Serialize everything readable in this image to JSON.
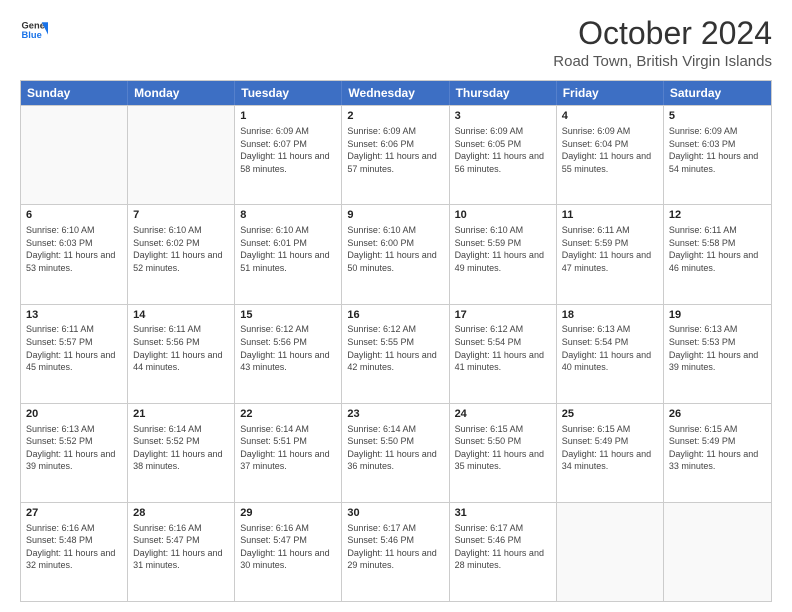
{
  "logo": {
    "line1": "General",
    "line2": "Blue"
  },
  "title": "October 2024",
  "subtitle": "Road Town, British Virgin Islands",
  "header_days": [
    "Sunday",
    "Monday",
    "Tuesday",
    "Wednesday",
    "Thursday",
    "Friday",
    "Saturday"
  ],
  "rows": [
    [
      {
        "day": "",
        "sunrise": "",
        "sunset": "",
        "daylight": ""
      },
      {
        "day": "",
        "sunrise": "",
        "sunset": "",
        "daylight": ""
      },
      {
        "day": "1",
        "sunrise": "Sunrise: 6:09 AM",
        "sunset": "Sunset: 6:07 PM",
        "daylight": "Daylight: 11 hours and 58 minutes."
      },
      {
        "day": "2",
        "sunrise": "Sunrise: 6:09 AM",
        "sunset": "Sunset: 6:06 PM",
        "daylight": "Daylight: 11 hours and 57 minutes."
      },
      {
        "day": "3",
        "sunrise": "Sunrise: 6:09 AM",
        "sunset": "Sunset: 6:05 PM",
        "daylight": "Daylight: 11 hours and 56 minutes."
      },
      {
        "day": "4",
        "sunrise": "Sunrise: 6:09 AM",
        "sunset": "Sunset: 6:04 PM",
        "daylight": "Daylight: 11 hours and 55 minutes."
      },
      {
        "day": "5",
        "sunrise": "Sunrise: 6:09 AM",
        "sunset": "Sunset: 6:03 PM",
        "daylight": "Daylight: 11 hours and 54 minutes."
      }
    ],
    [
      {
        "day": "6",
        "sunrise": "Sunrise: 6:10 AM",
        "sunset": "Sunset: 6:03 PM",
        "daylight": "Daylight: 11 hours and 53 minutes."
      },
      {
        "day": "7",
        "sunrise": "Sunrise: 6:10 AM",
        "sunset": "Sunset: 6:02 PM",
        "daylight": "Daylight: 11 hours and 52 minutes."
      },
      {
        "day": "8",
        "sunrise": "Sunrise: 6:10 AM",
        "sunset": "Sunset: 6:01 PM",
        "daylight": "Daylight: 11 hours and 51 minutes."
      },
      {
        "day": "9",
        "sunrise": "Sunrise: 6:10 AM",
        "sunset": "Sunset: 6:00 PM",
        "daylight": "Daylight: 11 hours and 50 minutes."
      },
      {
        "day": "10",
        "sunrise": "Sunrise: 6:10 AM",
        "sunset": "Sunset: 5:59 PM",
        "daylight": "Daylight: 11 hours and 49 minutes."
      },
      {
        "day": "11",
        "sunrise": "Sunrise: 6:11 AM",
        "sunset": "Sunset: 5:59 PM",
        "daylight": "Daylight: 11 hours and 47 minutes."
      },
      {
        "day": "12",
        "sunrise": "Sunrise: 6:11 AM",
        "sunset": "Sunset: 5:58 PM",
        "daylight": "Daylight: 11 hours and 46 minutes."
      }
    ],
    [
      {
        "day": "13",
        "sunrise": "Sunrise: 6:11 AM",
        "sunset": "Sunset: 5:57 PM",
        "daylight": "Daylight: 11 hours and 45 minutes."
      },
      {
        "day": "14",
        "sunrise": "Sunrise: 6:11 AM",
        "sunset": "Sunset: 5:56 PM",
        "daylight": "Daylight: 11 hours and 44 minutes."
      },
      {
        "day": "15",
        "sunrise": "Sunrise: 6:12 AM",
        "sunset": "Sunset: 5:56 PM",
        "daylight": "Daylight: 11 hours and 43 minutes."
      },
      {
        "day": "16",
        "sunrise": "Sunrise: 6:12 AM",
        "sunset": "Sunset: 5:55 PM",
        "daylight": "Daylight: 11 hours and 42 minutes."
      },
      {
        "day": "17",
        "sunrise": "Sunrise: 6:12 AM",
        "sunset": "Sunset: 5:54 PM",
        "daylight": "Daylight: 11 hours and 41 minutes."
      },
      {
        "day": "18",
        "sunrise": "Sunrise: 6:13 AM",
        "sunset": "Sunset: 5:54 PM",
        "daylight": "Daylight: 11 hours and 40 minutes."
      },
      {
        "day": "19",
        "sunrise": "Sunrise: 6:13 AM",
        "sunset": "Sunset: 5:53 PM",
        "daylight": "Daylight: 11 hours and 39 minutes."
      }
    ],
    [
      {
        "day": "20",
        "sunrise": "Sunrise: 6:13 AM",
        "sunset": "Sunset: 5:52 PM",
        "daylight": "Daylight: 11 hours and 39 minutes."
      },
      {
        "day": "21",
        "sunrise": "Sunrise: 6:14 AM",
        "sunset": "Sunset: 5:52 PM",
        "daylight": "Daylight: 11 hours and 38 minutes."
      },
      {
        "day": "22",
        "sunrise": "Sunrise: 6:14 AM",
        "sunset": "Sunset: 5:51 PM",
        "daylight": "Daylight: 11 hours and 37 minutes."
      },
      {
        "day": "23",
        "sunrise": "Sunrise: 6:14 AM",
        "sunset": "Sunset: 5:50 PM",
        "daylight": "Daylight: 11 hours and 36 minutes."
      },
      {
        "day": "24",
        "sunrise": "Sunrise: 6:15 AM",
        "sunset": "Sunset: 5:50 PM",
        "daylight": "Daylight: 11 hours and 35 minutes."
      },
      {
        "day": "25",
        "sunrise": "Sunrise: 6:15 AM",
        "sunset": "Sunset: 5:49 PM",
        "daylight": "Daylight: 11 hours and 34 minutes."
      },
      {
        "day": "26",
        "sunrise": "Sunrise: 6:15 AM",
        "sunset": "Sunset: 5:49 PM",
        "daylight": "Daylight: 11 hours and 33 minutes."
      }
    ],
    [
      {
        "day": "27",
        "sunrise": "Sunrise: 6:16 AM",
        "sunset": "Sunset: 5:48 PM",
        "daylight": "Daylight: 11 hours and 32 minutes."
      },
      {
        "day": "28",
        "sunrise": "Sunrise: 6:16 AM",
        "sunset": "Sunset: 5:47 PM",
        "daylight": "Daylight: 11 hours and 31 minutes."
      },
      {
        "day": "29",
        "sunrise": "Sunrise: 6:16 AM",
        "sunset": "Sunset: 5:47 PM",
        "daylight": "Daylight: 11 hours and 30 minutes."
      },
      {
        "day": "30",
        "sunrise": "Sunrise: 6:17 AM",
        "sunset": "Sunset: 5:46 PM",
        "daylight": "Daylight: 11 hours and 29 minutes."
      },
      {
        "day": "31",
        "sunrise": "Sunrise: 6:17 AM",
        "sunset": "Sunset: 5:46 PM",
        "daylight": "Daylight: 11 hours and 28 minutes."
      },
      {
        "day": "",
        "sunrise": "",
        "sunset": "",
        "daylight": ""
      },
      {
        "day": "",
        "sunrise": "",
        "sunset": "",
        "daylight": ""
      }
    ]
  ]
}
